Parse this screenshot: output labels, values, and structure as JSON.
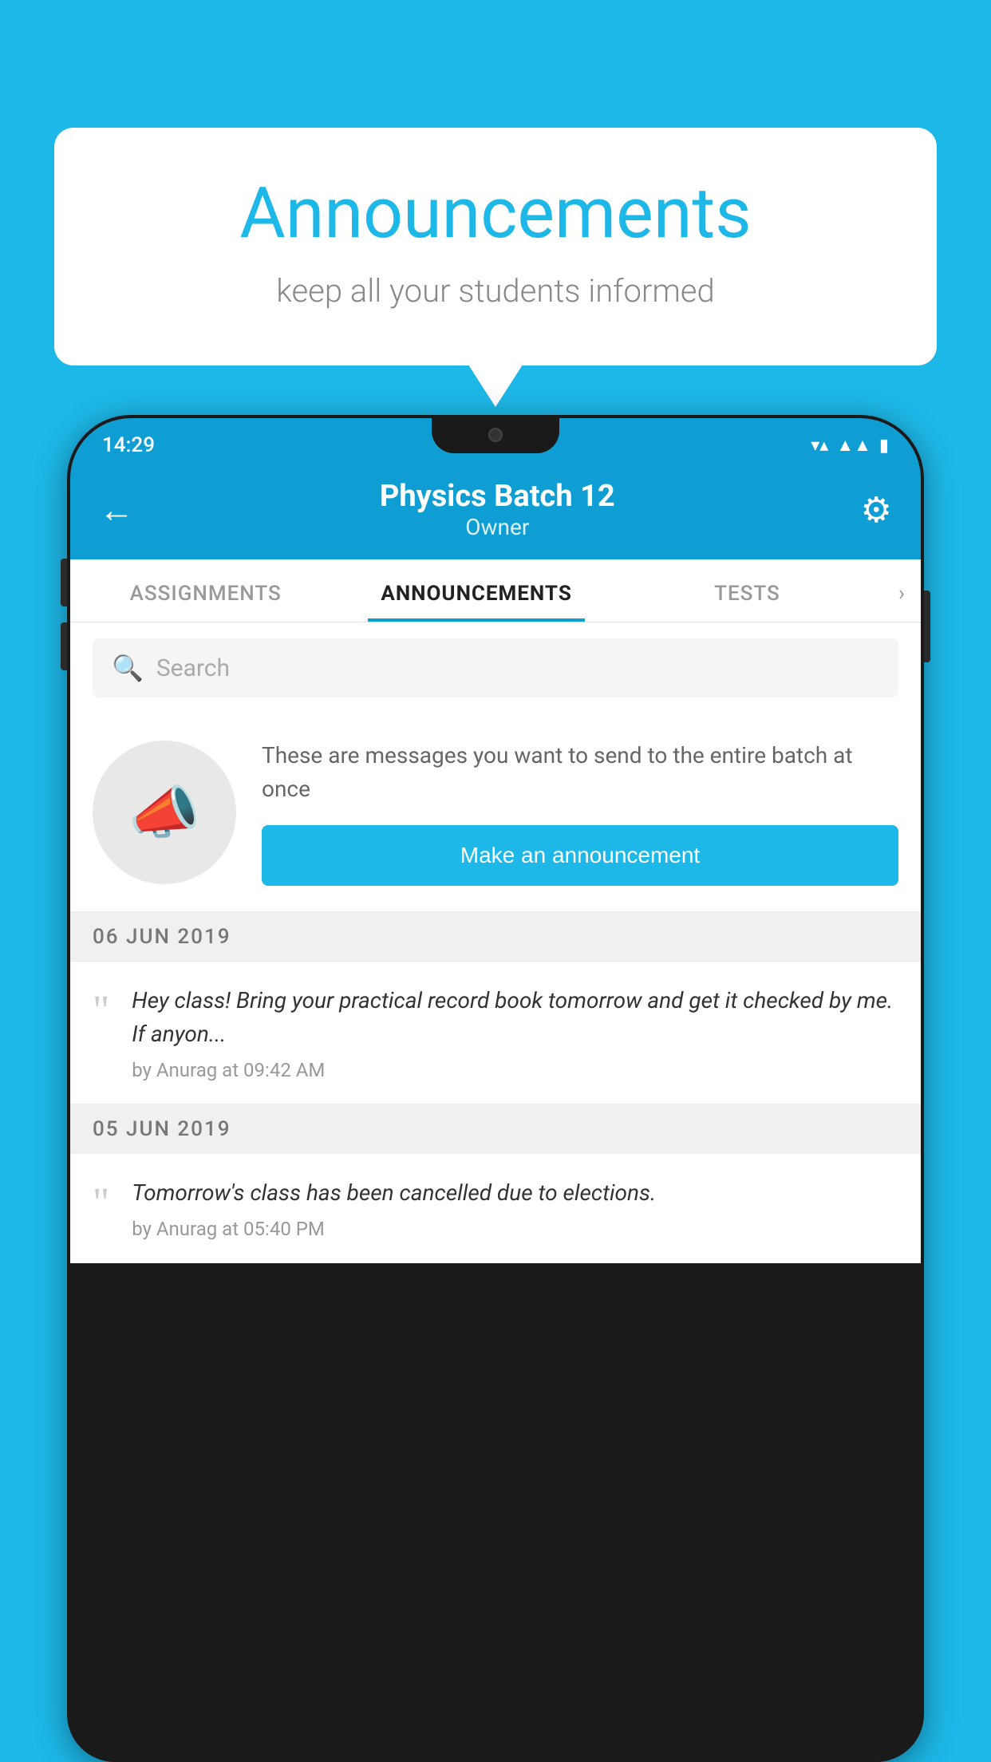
{
  "background_color": "#1DB8E8",
  "bubble": {
    "title": "Announcements",
    "subtitle": "keep all your students informed"
  },
  "status_bar": {
    "time": "14:29",
    "icons": [
      "wifi",
      "signal",
      "battery"
    ]
  },
  "header": {
    "title": "Physics Batch 12",
    "subtitle": "Owner",
    "back_label": "←",
    "gear_label": "⚙"
  },
  "tabs": [
    {
      "label": "ASSIGNMENTS",
      "active": false
    },
    {
      "label": "ANNOUNCEMENTS",
      "active": true
    },
    {
      "label": "TESTS",
      "active": false
    }
  ],
  "search": {
    "placeholder": "Search"
  },
  "announcement_intro": {
    "description": "These are messages you want to send to the entire batch at once",
    "button_label": "Make an announcement"
  },
  "messages": [
    {
      "date": "06  JUN  2019",
      "text": "Hey class! Bring your practical record book tomorrow and get it checked by me. If anyon...",
      "meta": "by Anurag at 09:42 AM"
    },
    {
      "date": "05  JUN  2019",
      "text": "Tomorrow's class has been cancelled due to elections.",
      "meta": "by Anurag at 05:40 PM"
    }
  ]
}
